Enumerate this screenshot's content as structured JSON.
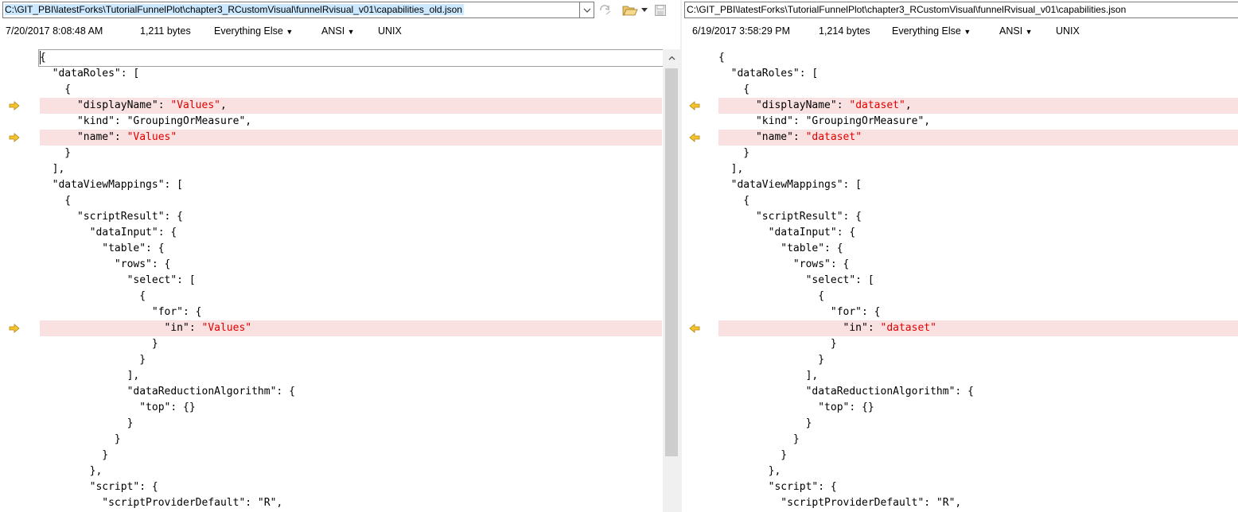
{
  "left": {
    "path": "C:\\GIT_PBI\\latestForks\\TutorialFunnelPlot\\chapter3_RCustomVisual\\funnelRvisual_v01\\capabilities_old.json",
    "info": {
      "datetime": "7/20/2017 8:08:48 AM",
      "size": "1,211 bytes",
      "filter": "Everything Else",
      "encoding": "ANSI",
      "line_endings": "UNIX"
    },
    "lines": [
      {
        "prefix": "{",
        "str": "",
        "suffix": "",
        "diff": false
      },
      {
        "prefix": "  \"dataRoles\": [",
        "str": "",
        "suffix": "",
        "diff": false
      },
      {
        "prefix": "    {",
        "str": "",
        "suffix": "",
        "diff": false
      },
      {
        "prefix": "      \"displayName\": ",
        "str": "\"Values\"",
        "suffix": ",",
        "diff": true
      },
      {
        "prefix": "      \"kind\": \"GroupingOrMeasure\",",
        "str": "",
        "suffix": "",
        "diff": false
      },
      {
        "prefix": "      \"name\": ",
        "str": "\"Values\"",
        "suffix": "",
        "diff": true
      },
      {
        "prefix": "    }",
        "str": "",
        "suffix": "",
        "diff": false
      },
      {
        "prefix": "  ],",
        "str": "",
        "suffix": "",
        "diff": false
      },
      {
        "prefix": "  \"dataViewMappings\": [",
        "str": "",
        "suffix": "",
        "diff": false
      },
      {
        "prefix": "    {",
        "str": "",
        "suffix": "",
        "diff": false
      },
      {
        "prefix": "      \"scriptResult\": {",
        "str": "",
        "suffix": "",
        "diff": false
      },
      {
        "prefix": "        \"dataInput\": {",
        "str": "",
        "suffix": "",
        "diff": false
      },
      {
        "prefix": "          \"table\": {",
        "str": "",
        "suffix": "",
        "diff": false
      },
      {
        "prefix": "            \"rows\": {",
        "str": "",
        "suffix": "",
        "diff": false
      },
      {
        "prefix": "              \"select\": [",
        "str": "",
        "suffix": "",
        "diff": false
      },
      {
        "prefix": "                {",
        "str": "",
        "suffix": "",
        "diff": false
      },
      {
        "prefix": "                  \"for\": {",
        "str": "",
        "suffix": "",
        "diff": false
      },
      {
        "prefix": "                    \"in\": ",
        "str": "\"Values\"",
        "suffix": "",
        "diff": true
      },
      {
        "prefix": "                  }",
        "str": "",
        "suffix": "",
        "diff": false
      },
      {
        "prefix": "                }",
        "str": "",
        "suffix": "",
        "diff": false
      },
      {
        "prefix": "              ],",
        "str": "",
        "suffix": "",
        "diff": false
      },
      {
        "prefix": "              \"dataReductionAlgorithm\": {",
        "str": "",
        "suffix": "",
        "diff": false
      },
      {
        "prefix": "                \"top\": {}",
        "str": "",
        "suffix": "",
        "diff": false
      },
      {
        "prefix": "              }",
        "str": "",
        "suffix": "",
        "diff": false
      },
      {
        "prefix": "            }",
        "str": "",
        "suffix": "",
        "diff": false
      },
      {
        "prefix": "          }",
        "str": "",
        "suffix": "",
        "diff": false
      },
      {
        "prefix": "        },",
        "str": "",
        "suffix": "",
        "diff": false
      },
      {
        "prefix": "        \"script\": {",
        "str": "",
        "suffix": "",
        "diff": false
      },
      {
        "prefix": "          \"scriptProviderDefault\": \"R\",",
        "str": "",
        "suffix": "",
        "diff": false
      }
    ]
  },
  "right": {
    "path": "C:\\GIT_PBI\\latestForks\\TutorialFunnelPlot\\chapter3_RCustomVisual\\funnelRvisual_v01\\capabilities.json",
    "info": {
      "datetime": "6/19/2017 3:58:29 PM",
      "size": "1,214 bytes",
      "filter": "Everything Else",
      "encoding": "ANSI",
      "line_endings": "UNIX"
    },
    "lines": [
      {
        "prefix": "{",
        "str": "",
        "suffix": "",
        "diff": false
      },
      {
        "prefix": "  \"dataRoles\": [",
        "str": "",
        "suffix": "",
        "diff": false
      },
      {
        "prefix": "    {",
        "str": "",
        "suffix": "",
        "diff": false
      },
      {
        "prefix": "      \"displayName\": ",
        "str": "\"dataset\"",
        "suffix": ",",
        "diff": true
      },
      {
        "prefix": "      \"kind\": \"GroupingOrMeasure\",",
        "str": "",
        "suffix": "",
        "diff": false
      },
      {
        "prefix": "      \"name\": ",
        "str": "\"dataset\"",
        "suffix": "",
        "diff": true
      },
      {
        "prefix": "    }",
        "str": "",
        "suffix": "",
        "diff": false
      },
      {
        "prefix": "  ],",
        "str": "",
        "suffix": "",
        "diff": false
      },
      {
        "prefix": "  \"dataViewMappings\": [",
        "str": "",
        "suffix": "",
        "diff": false
      },
      {
        "prefix": "    {",
        "str": "",
        "suffix": "",
        "diff": false
      },
      {
        "prefix": "      \"scriptResult\": {",
        "str": "",
        "suffix": "",
        "diff": false
      },
      {
        "prefix": "        \"dataInput\": {",
        "str": "",
        "suffix": "",
        "diff": false
      },
      {
        "prefix": "          \"table\": {",
        "str": "",
        "suffix": "",
        "diff": false
      },
      {
        "prefix": "            \"rows\": {",
        "str": "",
        "suffix": "",
        "diff": false
      },
      {
        "prefix": "              \"select\": [",
        "str": "",
        "suffix": "",
        "diff": false
      },
      {
        "prefix": "                {",
        "str": "",
        "suffix": "",
        "diff": false
      },
      {
        "prefix": "                  \"for\": {",
        "str": "",
        "suffix": "",
        "diff": false
      },
      {
        "prefix": "                    \"in\": ",
        "str": "\"dataset\"",
        "suffix": "",
        "diff": true
      },
      {
        "prefix": "                  }",
        "str": "",
        "suffix": "",
        "diff": false
      },
      {
        "prefix": "                }",
        "str": "",
        "suffix": "",
        "diff": false
      },
      {
        "prefix": "              ],",
        "str": "",
        "suffix": "",
        "diff": false
      },
      {
        "prefix": "              \"dataReductionAlgorithm\": {",
        "str": "",
        "suffix": "",
        "diff": false
      },
      {
        "prefix": "                \"top\": {}",
        "str": "",
        "suffix": "",
        "diff": false
      },
      {
        "prefix": "              }",
        "str": "",
        "suffix": "",
        "diff": false
      },
      {
        "prefix": "            }",
        "str": "",
        "suffix": "",
        "diff": false
      },
      {
        "prefix": "          }",
        "str": "",
        "suffix": "",
        "diff": false
      },
      {
        "prefix": "        },",
        "str": "",
        "suffix": "",
        "diff": false
      },
      {
        "prefix": "        \"script\": {",
        "str": "",
        "suffix": "",
        "diff": false
      },
      {
        "prefix": "          \"scriptProviderDefault\": \"R\",",
        "str": "",
        "suffix": "",
        "diff": false
      }
    ]
  },
  "colors": {
    "diff_background": "#fae1e1",
    "diff_string": "#e00000",
    "diff_arrow": "#f4c430",
    "path_selection": "#cce8ff"
  },
  "icons": {
    "left_arrow": "arrow-right-icon",
    "right_arrow": "arrow-left-icon",
    "refresh": "refresh-icon",
    "open": "folder-open-icon",
    "save": "save-icon"
  }
}
